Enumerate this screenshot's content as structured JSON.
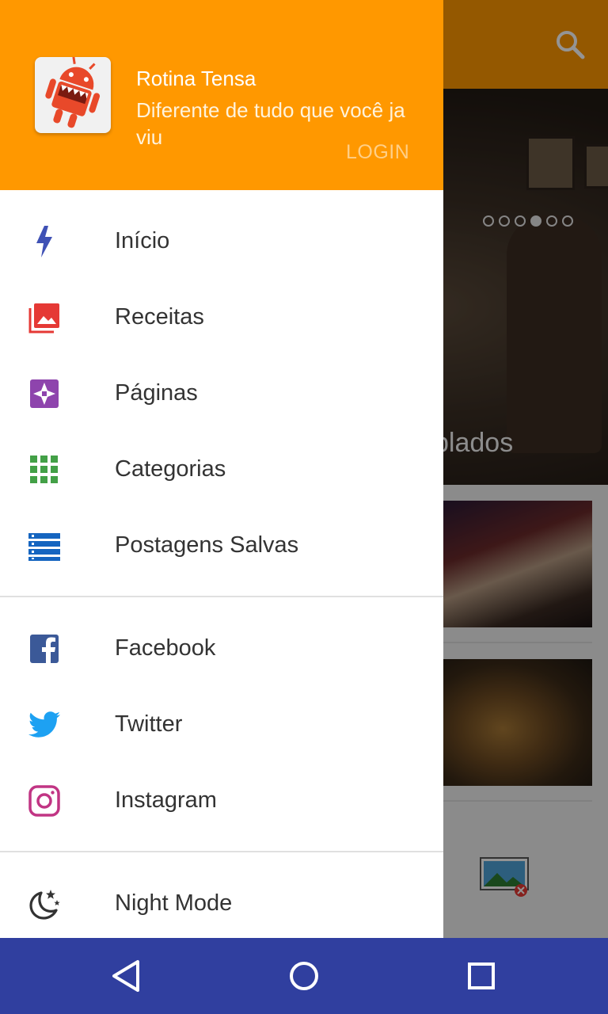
{
  "drawer": {
    "header": {
      "app_name": "Rotina Tensa",
      "subtitle": "Diferente de tudo que você ja viu",
      "login_label": "LOGIN"
    },
    "menu": [
      {
        "label": "Início",
        "icon": "lightning-icon",
        "color": "#3f51b5"
      },
      {
        "label": "Receitas",
        "icon": "photo-library-icon",
        "color": "#e53935"
      },
      {
        "label": "Páginas",
        "icon": "pages-icon",
        "color": "#8e44ad"
      },
      {
        "label": "Categorias",
        "icon": "grid-icon",
        "color": "#43a047"
      },
      {
        "label": "Postagens Salvas",
        "icon": "list-icon",
        "color": "#1565c0"
      }
    ],
    "social": [
      {
        "label": "Facebook",
        "icon": "facebook-icon",
        "color": "#3b5998"
      },
      {
        "label": "Twitter",
        "icon": "twitter-icon",
        "color": "#1da1f2"
      },
      {
        "label": "Instagram",
        "icon": "instagram-icon",
        "color": "#c13584"
      }
    ],
    "settings": [
      {
        "label": "Night Mode",
        "icon": "moon-stars-icon",
        "color": "#333333"
      }
    ]
  },
  "background": {
    "hero_caption": "plados",
    "slider_dots": 6,
    "slider_active_index": 3
  },
  "colors": {
    "primary": "#ff9800",
    "navbar": "#303f9f"
  }
}
